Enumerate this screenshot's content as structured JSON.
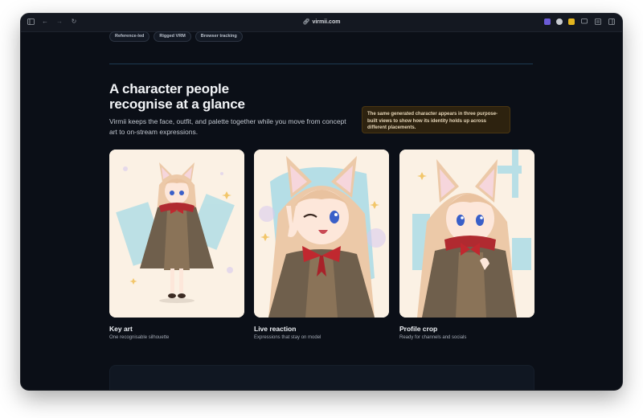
{
  "browser": {
    "url": "virmii.com"
  },
  "tags": [
    "Reference-led",
    "Rigged VRM",
    "Browser tracking"
  ],
  "hero": {
    "headline_line1": "A character people",
    "headline_line2": "recognise at a glance",
    "lede": "Virmii keeps the face, outfit, and palette together while you move from concept art to on-stream expressions.",
    "note": "The same generated character appears in three purpose-built views to show how its identity holds up across different placements."
  },
  "cards": [
    {
      "title": "Key art",
      "subtitle": "One recognisable silhouette"
    },
    {
      "title": "Live reaction",
      "subtitle": "Expressions that stay on model"
    },
    {
      "title": "Profile crop",
      "subtitle": "Ready for channels and socials"
    }
  ],
  "colors": {
    "page_bg": "#0b0f17",
    "note_bg": "#2d220f",
    "hair": "#ecc9a8",
    "cloak": "#6f5f4c",
    "ribbon": "#c0282f",
    "eyes": "#3a5fc8"
  }
}
